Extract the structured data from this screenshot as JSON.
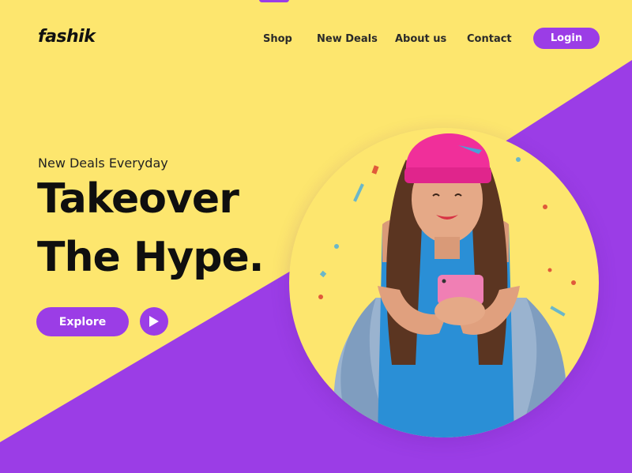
{
  "brand": {
    "logo": "fashik"
  },
  "nav": {
    "items": [
      {
        "label": "Shop"
      },
      {
        "label": "New Deals"
      },
      {
        "label": "About us"
      },
      {
        "label": "Contact"
      }
    ],
    "login_label": "Login"
  },
  "hero": {
    "subtitle": "New Deals Everyday",
    "headline_line1": "Takeover",
    "headline_line2": "The Hype.",
    "explore_label": "Explore",
    "play_icon": "play-icon"
  },
  "colors": {
    "background": "#fde66e",
    "accent": "#9b3de6",
    "text": "#0f0f0f"
  }
}
